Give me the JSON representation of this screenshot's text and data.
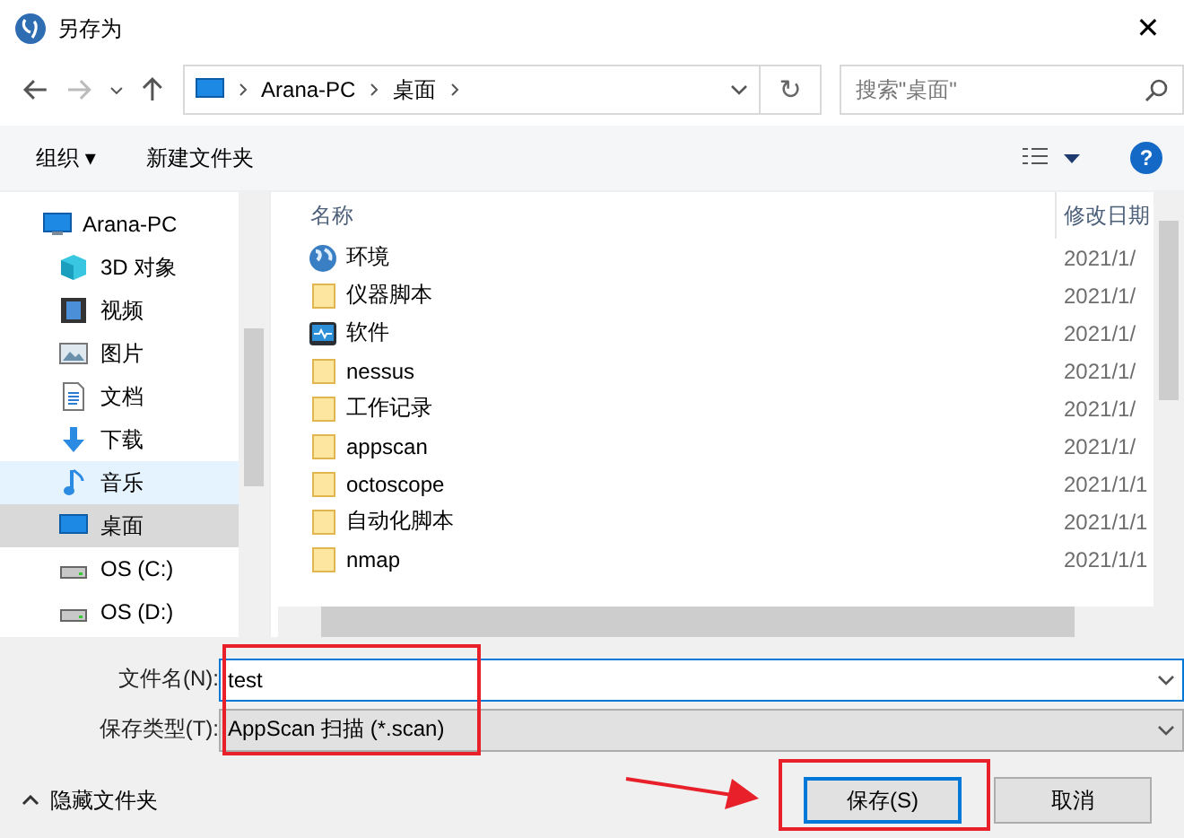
{
  "window": {
    "title": "另存为",
    "close": "✕"
  },
  "address": {
    "crumbs": [
      "Arana-PC",
      "桌面"
    ],
    "refresh": "↻"
  },
  "search": {
    "placeholder": "搜索\"桌面\""
  },
  "toolbar": {
    "organize": "组织 ▾",
    "new_folder": "新建文件夹",
    "help": "?"
  },
  "sidebar": {
    "items": [
      {
        "label": "Arana-PC",
        "kind": "pc",
        "selected": false,
        "hovered": false,
        "children": [
          {
            "label": "3D 对象",
            "kind": "cube",
            "selected": false,
            "hovered": false
          },
          {
            "label": "视频",
            "kind": "video",
            "selected": false,
            "hovered": false
          },
          {
            "label": "图片",
            "kind": "picture",
            "selected": false,
            "hovered": false
          },
          {
            "label": "文档",
            "kind": "document",
            "selected": false,
            "hovered": false
          },
          {
            "label": "下载",
            "kind": "download",
            "selected": false,
            "hovered": false
          },
          {
            "label": "音乐",
            "kind": "music",
            "selected": false,
            "hovered": true
          },
          {
            "label": "桌面",
            "kind": "desktop",
            "selected": true,
            "hovered": false
          },
          {
            "label": "OS (C:)",
            "kind": "drive",
            "selected": false,
            "hovered": false
          },
          {
            "label": "OS (D:)",
            "kind": "drive",
            "selected": false,
            "hovered": false
          }
        ]
      }
    ]
  },
  "table": {
    "columns": [
      "名称",
      "修改日期"
    ],
    "rows": [
      {
        "kind": "globe",
        "name": "环境",
        "date": "2021/1/"
      },
      {
        "kind": "folder",
        "name": "仪器脚本",
        "date": "2021/1/"
      },
      {
        "kind": "app",
        "name": "软件",
        "date": "2021/1/"
      },
      {
        "kind": "folder",
        "name": "nessus",
        "date": "2021/1/"
      },
      {
        "kind": "folder",
        "name": "工作记录",
        "date": "2021/1/"
      },
      {
        "kind": "folder",
        "name": "appscan",
        "date": "2021/1/"
      },
      {
        "kind": "folder",
        "name": "octoscope",
        "date": "2021/1/1"
      },
      {
        "kind": "folder",
        "name": "自动化脚本",
        "date": "2021/1/1"
      },
      {
        "kind": "folder",
        "name": "nmap",
        "date": "2021/1/1"
      }
    ]
  },
  "form": {
    "filename_label": "文件名(N):",
    "filename": "test",
    "type_label": "保存类型(T):",
    "type": "AppScan 扫描 (*.scan)"
  },
  "footer": {
    "hide_folders": "隐藏文件夹",
    "buttons": [
      {
        "label": "保存(S)",
        "selected": true
      },
      {
        "label": "取消",
        "selected": false
      }
    ]
  }
}
